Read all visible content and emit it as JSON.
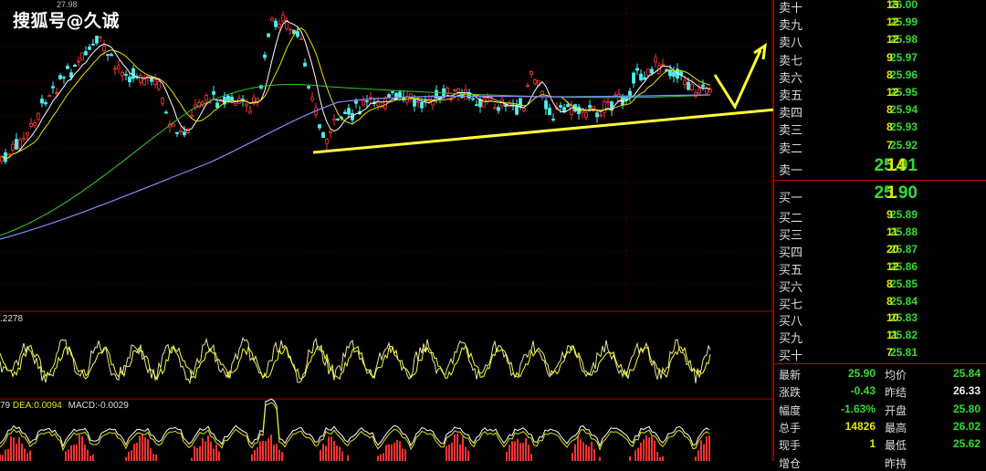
{
  "watermark": "搜狐号@久诚",
  "top_price_label": "27.98",
  "indicator1": {
    "label": ".2278"
  },
  "indicator2": {
    "prefix": "79",
    "dea": "DEA:0.0094",
    "macd": "MACD:-0.0029"
  },
  "colors": {
    "up": "#ff3232",
    "down": "#32dc32",
    "volume": "#e6e600",
    "divider": "#b00000"
  },
  "order_book": {
    "asks": [
      {
        "label": "卖十",
        "price": "26.00",
        "qty": "13"
      },
      {
        "label": "卖九",
        "price": "25.99",
        "qty": "12"
      },
      {
        "label": "卖八",
        "price": "25.98",
        "qty": "12"
      },
      {
        "label": "卖七",
        "price": "25.97",
        "qty": "9"
      },
      {
        "label": "卖六",
        "price": "25.96",
        "qty": "8"
      },
      {
        "label": "卖五",
        "price": "25.95",
        "qty": "12"
      },
      {
        "label": "卖四",
        "price": "25.94",
        "qty": "8"
      },
      {
        "label": "卖三",
        "price": "25.93",
        "qty": "8"
      },
      {
        "label": "卖二",
        "price": "25.92",
        "qty": "7"
      },
      {
        "label": "卖一",
        "price": "25.91",
        "qty": "14"
      }
    ],
    "bids": [
      {
        "label": "买一",
        "price": "25.90",
        "qty": "1"
      },
      {
        "label": "买二",
        "price": "25.89",
        "qty": "9"
      },
      {
        "label": "买三",
        "price": "25.88",
        "qty": "11"
      },
      {
        "label": "买四",
        "price": "25.87",
        "qty": "20"
      },
      {
        "label": "买五",
        "price": "25.86",
        "qty": "12"
      },
      {
        "label": "买六",
        "price": "25.85",
        "qty": "8"
      },
      {
        "label": "买七",
        "price": "25.84",
        "qty": "8"
      },
      {
        "label": "买八",
        "price": "25.83",
        "qty": "10"
      },
      {
        "label": "买九",
        "price": "25.82",
        "qty": "11"
      },
      {
        "label": "买十",
        "price": "25.81",
        "qty": "7"
      }
    ]
  },
  "stats": [
    {
      "l1": "最新",
      "v1": "25.90",
      "l2": "均价",
      "v2": "25.84"
    },
    {
      "l1": "涨跌",
      "v1": "-0.43",
      "l2": "昨结",
      "v2": "26.33"
    },
    {
      "l1": "幅度",
      "v1": "-1.63%",
      "l2": "开盘",
      "v2": "25.80"
    },
    {
      "l1": "总手",
      "v1": "14826",
      "l2": "最高",
      "v2": "26.02"
    },
    {
      "l1": "现手",
      "v1": "1",
      "l2": "最低",
      "v2": "25.62"
    },
    {
      "l1": "增仓",
      "v1": "",
      "l2": "昨持",
      "v2": ""
    }
  ]
}
